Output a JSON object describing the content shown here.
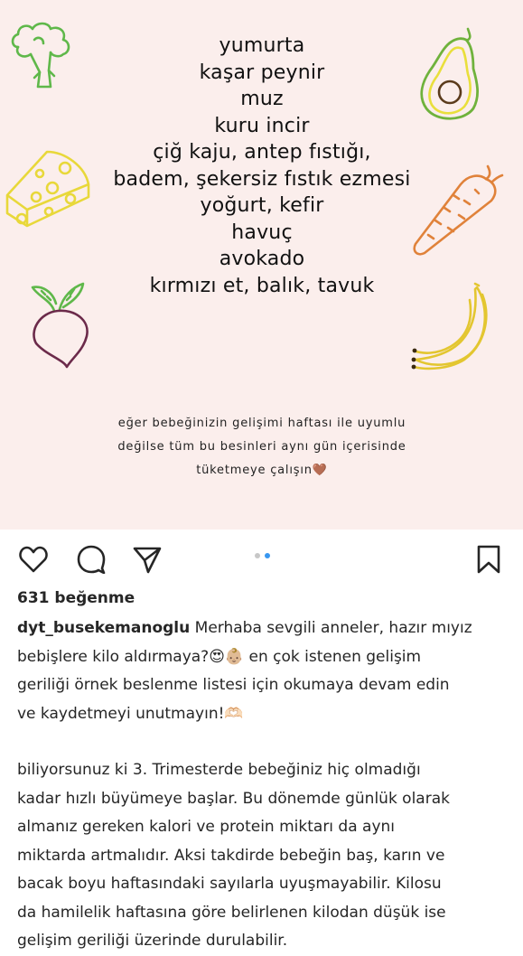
{
  "post": {
    "foods": [
      "yumurta",
      "kaşar peynir",
      "muz",
      "kuru incir",
      "çiğ kaju, antep fıstığı,",
      "badem, şekersiz fıstık ezmesi",
      "yoğurt, kefir",
      "havuç",
      "avokado",
      "kırmızı et, balık, tavuk"
    ],
    "note_lines": [
      "eğer bebeğinizin gelişimi haftası ile uyumlu",
      "değilse tüm bu besinleri aynı gün içerisinde",
      "tüketmeye çalışın🤎"
    ],
    "carousel": {
      "count": 2,
      "active": 2
    }
  },
  "actions": {
    "icons": [
      "heart-icon",
      "comment-icon",
      "share-icon",
      "bookmark-icon"
    ]
  },
  "likes_text": "631 beğenme",
  "caption": {
    "username": "dyt_busekemanoglu",
    "lines": [
      "Merhaba sevgili anneler, hazır mıyız",
      "bebişlere kilo aldırmaya?😍👶🏼 en çok istenen gelişim",
      "geriliği örnek beslenme listesi için okumaya devam edin",
      "ve kaydetmeyi unutmayın!🫶🏻"
    ],
    "body_lines": [
      "biliyorsunuz ki 3. Trimesterde bebeğiniz hiç olmadığı",
      "kadar hızlı büyümeye başlar. Bu dönemde günlük olarak",
      "almanız gereken kalori ve protein miktarı da aynı",
      "miktarda artmalıdır. Aksi takdirde bebeğin baş, karın ve",
      "bacak boyu haftasındaki sayılarla uyuşmayabilir. Kilosu",
      "da hamilelik haftasına göre belirlenen kilodan düşük ise",
      "gelişim geriliği üzerinde durulabilir."
    ]
  },
  "colors": {
    "post_bg": "#fbeeec",
    "broccoli": "#5fb84a",
    "cheese": "#e8d83a",
    "avocado_skin": "#6fb23c",
    "avocado_flesh": "#e9df3c",
    "avocado_pit": "#5b3b1c",
    "carrot": "#e0823a",
    "beet": "#6b2a4a",
    "banana": "#e3c630",
    "dot_active": "#3897f0"
  }
}
